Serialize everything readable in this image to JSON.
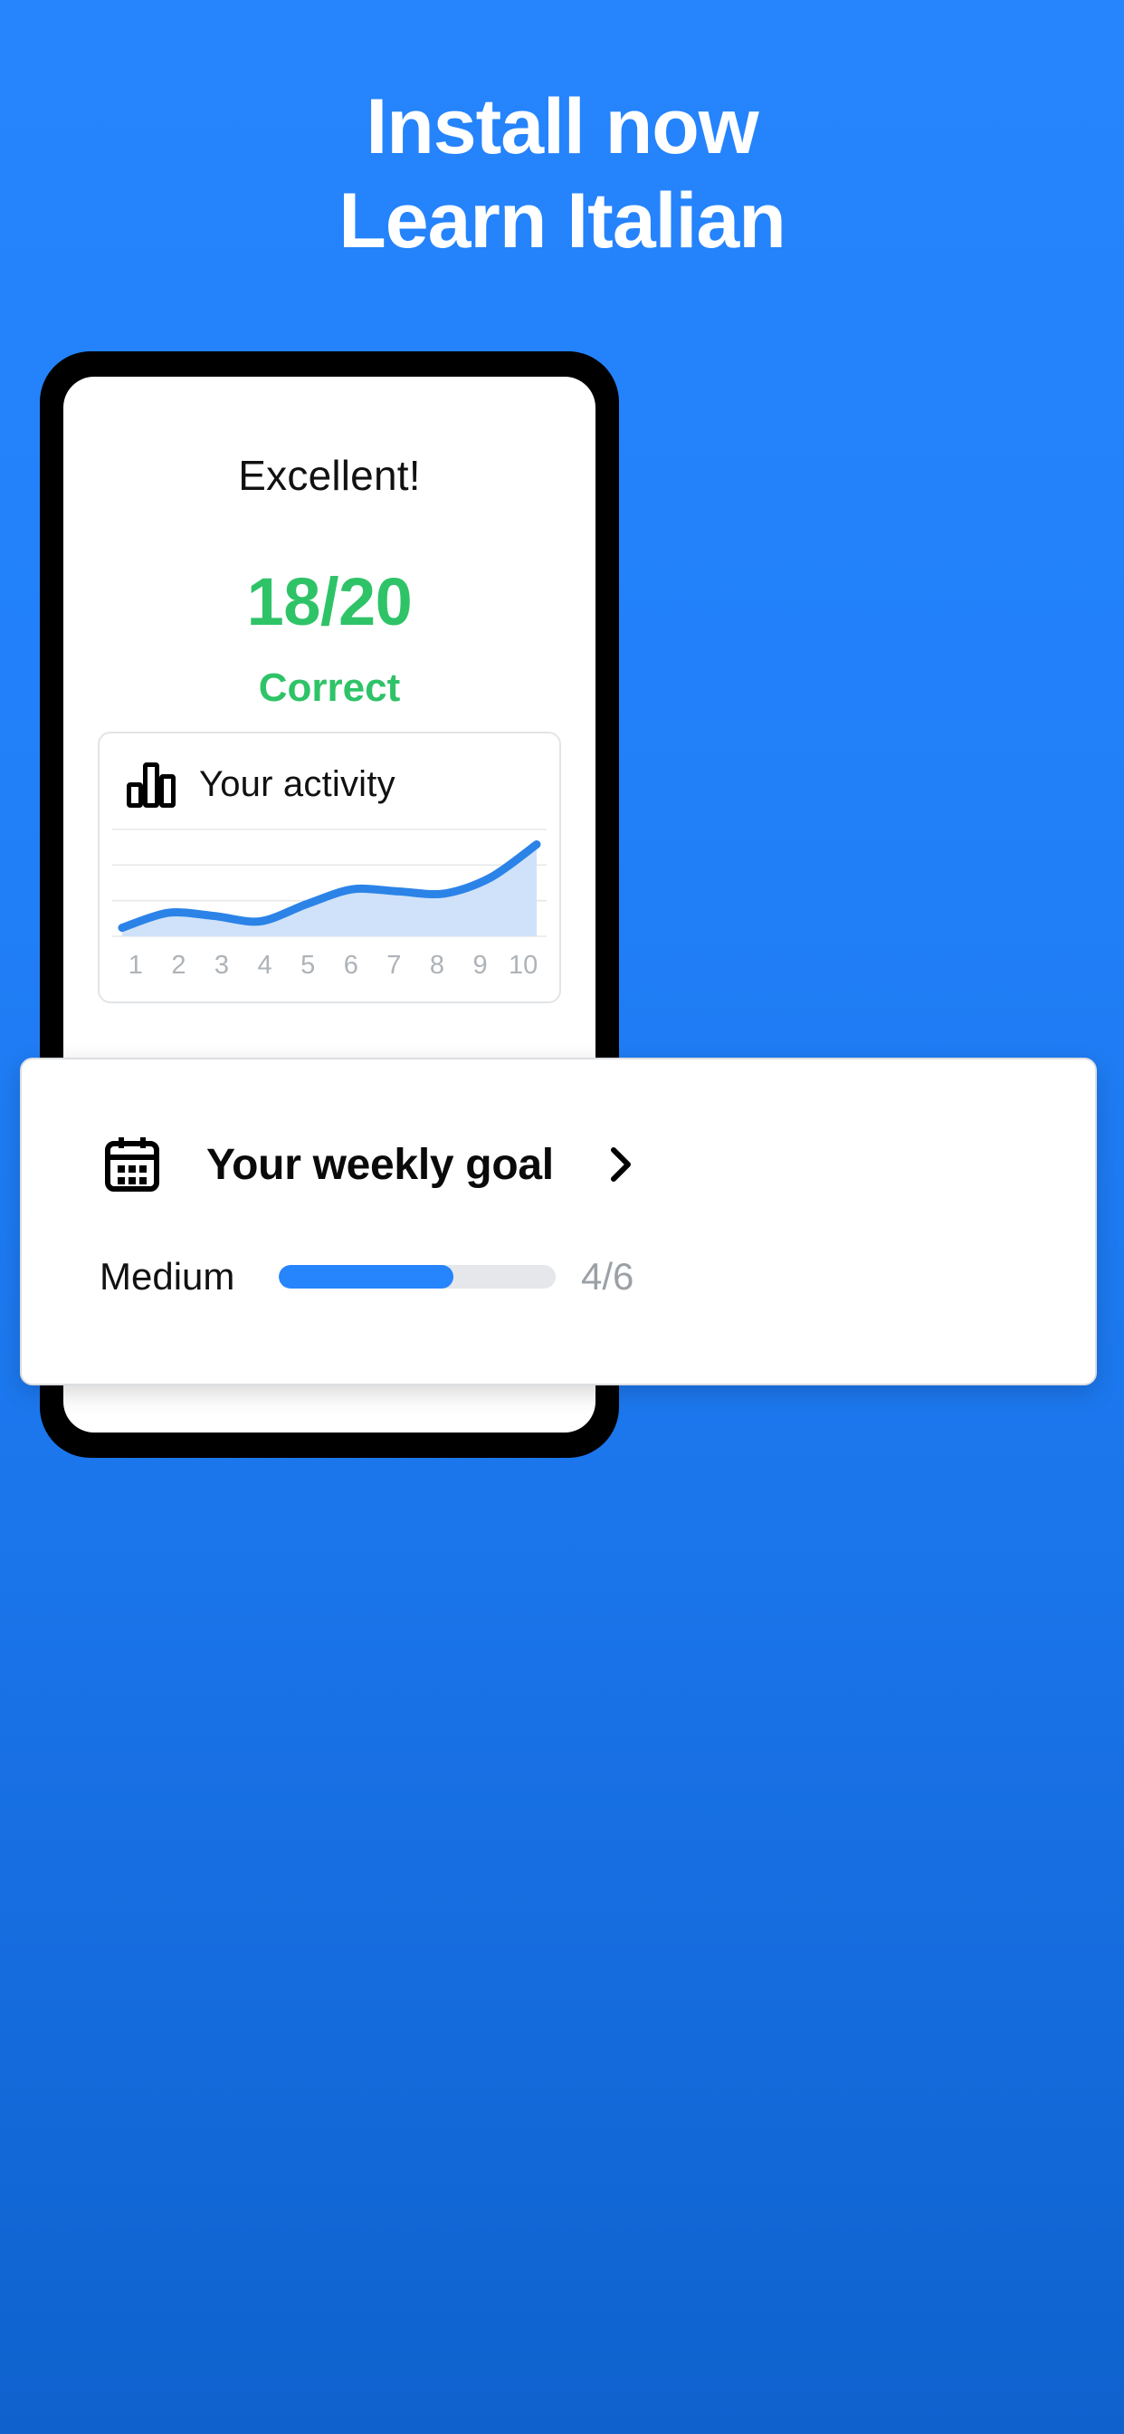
{
  "promo": {
    "headline_line1": "Install now",
    "headline_line2": "Learn Italian"
  },
  "colors": {
    "background_top": "#2684FC",
    "background_bottom": "#0F62CE",
    "accent_blue": "#2684FC",
    "success_green": "#2FC368",
    "chart_line": "#2B83E8",
    "chart_fill": "#CFE2F9",
    "muted_gray": "#AEB3B8"
  },
  "screen": {
    "result": {
      "title": "Excellent!",
      "score": "18/20",
      "caption": "Correct"
    },
    "activity_card": {
      "icon": "bar-chart-icon",
      "title": "Your activity"
    },
    "goal_card": {
      "icon": "calendar-icon",
      "title": "Your weekly goal",
      "chevron": "chevron-right-icon",
      "level": "Medium",
      "count": "4/6",
      "progress_percent": 63
    }
  },
  "chart_data": {
    "type": "area",
    "title": "Your activity",
    "categories": [
      "1",
      "2",
      "3",
      "4",
      "5",
      "6",
      "7",
      "8",
      "9",
      "10"
    ],
    "x": [
      1,
      2,
      3,
      4,
      5,
      6,
      7,
      8,
      9,
      10
    ],
    "values": [
      8,
      22,
      19,
      14,
      30,
      44,
      42,
      40,
      55,
      86
    ],
    "series": [
      {
        "name": "activity",
        "values": [
          8,
          22,
          19,
          14,
          30,
          44,
          42,
          40,
          55,
          86
        ]
      }
    ],
    "xlabel": "",
    "ylabel": "",
    "ylim": [
      0,
      100
    ],
    "grid": true,
    "gridlines": 4,
    "legend": "none",
    "line_color": "#2B83E8",
    "fill_color": "#CFE2F9"
  }
}
